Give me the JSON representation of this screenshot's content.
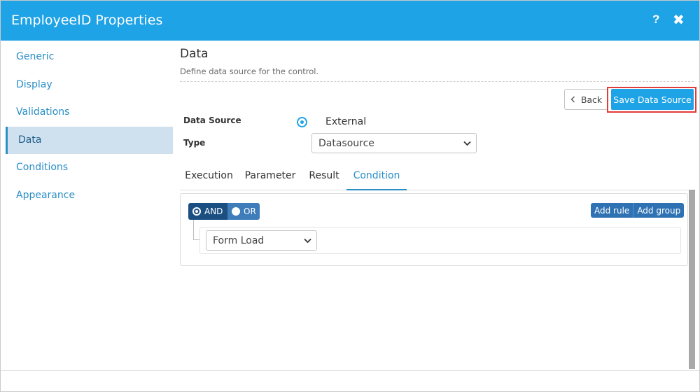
{
  "window": {
    "title": "EmployeeID Properties",
    "help_label": "?",
    "close_label": "✖"
  },
  "sidebar": {
    "items": [
      {
        "label": "Generic"
      },
      {
        "label": "Display"
      },
      {
        "label": "Validations"
      },
      {
        "label": "Data",
        "active": true
      },
      {
        "label": "Conditions"
      },
      {
        "label": "Appearance"
      }
    ]
  },
  "section": {
    "title": "Data",
    "description": "Define data source for the control."
  },
  "toolbar": {
    "back_label": "Back",
    "save_label": "Save Data Source"
  },
  "form": {
    "data_source_label": "Data Source",
    "data_source_value": "External",
    "type_label": "Type",
    "type_value": "Datasource"
  },
  "tabs": [
    {
      "label": "Execution"
    },
    {
      "label": "Parameter"
    },
    {
      "label": "Result"
    },
    {
      "label": "Condition",
      "active": true
    }
  ],
  "builder": {
    "and_label": "AND",
    "or_label": "OR",
    "add_rule_label": "Add rule",
    "add_group_label": "Add group",
    "rule_select_value": "Form Load"
  },
  "colors": {
    "accent": "#1ea3e6",
    "highlight": "#e23b3b",
    "group_and": "#1b4f82"
  },
  "icons": {
    "back": "chevron-left-icon",
    "select": "chevron-down-icon",
    "help": "help-icon",
    "close": "close-icon"
  }
}
